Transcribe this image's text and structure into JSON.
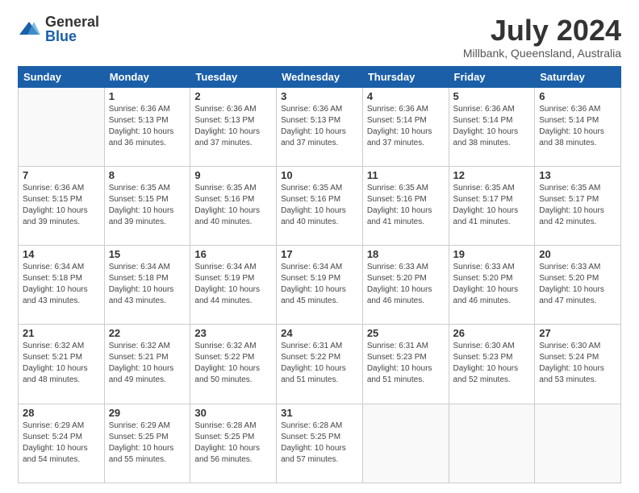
{
  "logo": {
    "general": "General",
    "blue": "Blue"
  },
  "title": "July 2024",
  "subtitle": "Millbank, Queensland, Australia",
  "days_of_week": [
    "Sunday",
    "Monday",
    "Tuesday",
    "Wednesday",
    "Thursday",
    "Friday",
    "Saturday"
  ],
  "weeks": [
    [
      {
        "day": null,
        "sunrise": null,
        "sunset": null,
        "daylight": null
      },
      {
        "day": "1",
        "sunrise": "Sunrise: 6:36 AM",
        "sunset": "Sunset: 5:13 PM",
        "daylight": "Daylight: 10 hours and 36 minutes."
      },
      {
        "day": "2",
        "sunrise": "Sunrise: 6:36 AM",
        "sunset": "Sunset: 5:13 PM",
        "daylight": "Daylight: 10 hours and 37 minutes."
      },
      {
        "day": "3",
        "sunrise": "Sunrise: 6:36 AM",
        "sunset": "Sunset: 5:13 PM",
        "daylight": "Daylight: 10 hours and 37 minutes."
      },
      {
        "day": "4",
        "sunrise": "Sunrise: 6:36 AM",
        "sunset": "Sunset: 5:14 PM",
        "daylight": "Daylight: 10 hours and 37 minutes."
      },
      {
        "day": "5",
        "sunrise": "Sunrise: 6:36 AM",
        "sunset": "Sunset: 5:14 PM",
        "daylight": "Daylight: 10 hours and 38 minutes."
      },
      {
        "day": "6",
        "sunrise": "Sunrise: 6:36 AM",
        "sunset": "Sunset: 5:14 PM",
        "daylight": "Daylight: 10 hours and 38 minutes."
      }
    ],
    [
      {
        "day": "7",
        "sunrise": "Sunrise: 6:36 AM",
        "sunset": "Sunset: 5:15 PM",
        "daylight": "Daylight: 10 hours and 39 minutes."
      },
      {
        "day": "8",
        "sunrise": "Sunrise: 6:35 AM",
        "sunset": "Sunset: 5:15 PM",
        "daylight": "Daylight: 10 hours and 39 minutes."
      },
      {
        "day": "9",
        "sunrise": "Sunrise: 6:35 AM",
        "sunset": "Sunset: 5:16 PM",
        "daylight": "Daylight: 10 hours and 40 minutes."
      },
      {
        "day": "10",
        "sunrise": "Sunrise: 6:35 AM",
        "sunset": "Sunset: 5:16 PM",
        "daylight": "Daylight: 10 hours and 40 minutes."
      },
      {
        "day": "11",
        "sunrise": "Sunrise: 6:35 AM",
        "sunset": "Sunset: 5:16 PM",
        "daylight": "Daylight: 10 hours and 41 minutes."
      },
      {
        "day": "12",
        "sunrise": "Sunrise: 6:35 AM",
        "sunset": "Sunset: 5:17 PM",
        "daylight": "Daylight: 10 hours and 41 minutes."
      },
      {
        "day": "13",
        "sunrise": "Sunrise: 6:35 AM",
        "sunset": "Sunset: 5:17 PM",
        "daylight": "Daylight: 10 hours and 42 minutes."
      }
    ],
    [
      {
        "day": "14",
        "sunrise": "Sunrise: 6:34 AM",
        "sunset": "Sunset: 5:18 PM",
        "daylight": "Daylight: 10 hours and 43 minutes."
      },
      {
        "day": "15",
        "sunrise": "Sunrise: 6:34 AM",
        "sunset": "Sunset: 5:18 PM",
        "daylight": "Daylight: 10 hours and 43 minutes."
      },
      {
        "day": "16",
        "sunrise": "Sunrise: 6:34 AM",
        "sunset": "Sunset: 5:19 PM",
        "daylight": "Daylight: 10 hours and 44 minutes."
      },
      {
        "day": "17",
        "sunrise": "Sunrise: 6:34 AM",
        "sunset": "Sunset: 5:19 PM",
        "daylight": "Daylight: 10 hours and 45 minutes."
      },
      {
        "day": "18",
        "sunrise": "Sunrise: 6:33 AM",
        "sunset": "Sunset: 5:20 PM",
        "daylight": "Daylight: 10 hours and 46 minutes."
      },
      {
        "day": "19",
        "sunrise": "Sunrise: 6:33 AM",
        "sunset": "Sunset: 5:20 PM",
        "daylight": "Daylight: 10 hours and 46 minutes."
      },
      {
        "day": "20",
        "sunrise": "Sunrise: 6:33 AM",
        "sunset": "Sunset: 5:20 PM",
        "daylight": "Daylight: 10 hours and 47 minutes."
      }
    ],
    [
      {
        "day": "21",
        "sunrise": "Sunrise: 6:32 AM",
        "sunset": "Sunset: 5:21 PM",
        "daylight": "Daylight: 10 hours and 48 minutes."
      },
      {
        "day": "22",
        "sunrise": "Sunrise: 6:32 AM",
        "sunset": "Sunset: 5:21 PM",
        "daylight": "Daylight: 10 hours and 49 minutes."
      },
      {
        "day": "23",
        "sunrise": "Sunrise: 6:32 AM",
        "sunset": "Sunset: 5:22 PM",
        "daylight": "Daylight: 10 hours and 50 minutes."
      },
      {
        "day": "24",
        "sunrise": "Sunrise: 6:31 AM",
        "sunset": "Sunset: 5:22 PM",
        "daylight": "Daylight: 10 hours and 51 minutes."
      },
      {
        "day": "25",
        "sunrise": "Sunrise: 6:31 AM",
        "sunset": "Sunset: 5:23 PM",
        "daylight": "Daylight: 10 hours and 51 minutes."
      },
      {
        "day": "26",
        "sunrise": "Sunrise: 6:30 AM",
        "sunset": "Sunset: 5:23 PM",
        "daylight": "Daylight: 10 hours and 52 minutes."
      },
      {
        "day": "27",
        "sunrise": "Sunrise: 6:30 AM",
        "sunset": "Sunset: 5:24 PM",
        "daylight": "Daylight: 10 hours and 53 minutes."
      }
    ],
    [
      {
        "day": "28",
        "sunrise": "Sunrise: 6:29 AM",
        "sunset": "Sunset: 5:24 PM",
        "daylight": "Daylight: 10 hours and 54 minutes."
      },
      {
        "day": "29",
        "sunrise": "Sunrise: 6:29 AM",
        "sunset": "Sunset: 5:25 PM",
        "daylight": "Daylight: 10 hours and 55 minutes."
      },
      {
        "day": "30",
        "sunrise": "Sunrise: 6:28 AM",
        "sunset": "Sunset: 5:25 PM",
        "daylight": "Daylight: 10 hours and 56 minutes."
      },
      {
        "day": "31",
        "sunrise": "Sunrise: 6:28 AM",
        "sunset": "Sunset: 5:25 PM",
        "daylight": "Daylight: 10 hours and 57 minutes."
      },
      {
        "day": null,
        "sunrise": null,
        "sunset": null,
        "daylight": null
      },
      {
        "day": null,
        "sunrise": null,
        "sunset": null,
        "daylight": null
      },
      {
        "day": null,
        "sunrise": null,
        "sunset": null,
        "daylight": null
      }
    ]
  ]
}
